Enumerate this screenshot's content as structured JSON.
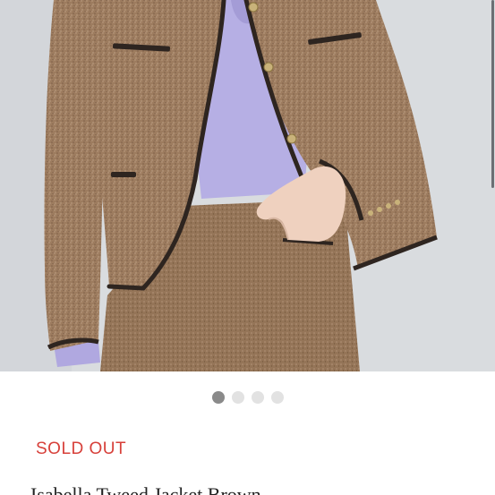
{
  "product": {
    "photo_label": "Tweed jacket product photo",
    "status": "SOLD OUT",
    "title": "Isabella Tweed Jacket Brown"
  },
  "carousel": {
    "total": 4,
    "active_index": 0
  },
  "colors": {
    "status_red": "#d7403a",
    "dot_active": "#8a8a8a",
    "dot_inactive": "#e2e2e2",
    "tweed_brown": "#9c7a5c",
    "sweater_lavender": "#b7b0e6"
  }
}
